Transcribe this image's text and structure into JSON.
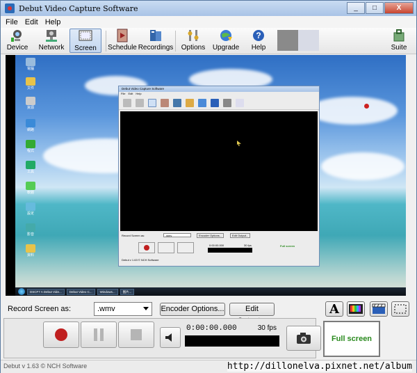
{
  "window": {
    "title": "Debut Video Capture Software",
    "buttons": [
      "_",
      "□",
      "X"
    ]
  },
  "menu": [
    "File",
    "Edit",
    "Help"
  ],
  "toolbar": {
    "items": [
      {
        "label": "Device",
        "icon": "webcam-icon"
      },
      {
        "label": "Network",
        "icon": "network-camera-icon"
      },
      {
        "label": "Screen",
        "icon": "screen-icon",
        "active": true
      },
      {
        "label": "Schedule",
        "icon": "schedule-icon"
      },
      {
        "label": "Recordings",
        "icon": "recordings-icon"
      },
      {
        "label": "Options",
        "icon": "options-icon"
      },
      {
        "label": "Upgrade",
        "icon": "upgrade-globe-icon"
      },
      {
        "label": "Help",
        "icon": "help-icon"
      },
      {
        "label": "Suite",
        "icon": "suite-icon"
      }
    ]
  },
  "preview": {
    "inner_window": {
      "title": "Debut Video Capture Software",
      "menu": [
        "File",
        "Edit",
        "Help"
      ],
      "toolbar": [
        "Device",
        "Network",
        "Screen",
        "Schedule",
        "Recordings",
        "Options",
        "Upgrade",
        "Help",
        "Suite"
      ],
      "record_label": "Record Screen as:",
      "format": ".wmv",
      "encoder": "Encoder Options...",
      "edit_output": "Edit Output...",
      "time": "0:00:00.000",
      "fps": "30 fps",
      "full_screen": "Full screen",
      "status": "Debut v 1.63 © NCH Software"
    },
    "taskbar_items": [
      "DSCF7 A Debut Vide...",
      "Debut Video C...",
      "Windows...",
      "图片..."
    ]
  },
  "controls": {
    "record_label": "Record Screen as:",
    "format_value": ".wmv",
    "encoder_button": "Encoder Options...",
    "edit_output_button": "Edit Output...",
    "time": "0:00:00.000",
    "fps": "30 fps",
    "full_screen": "Full screen"
  },
  "status": {
    "text": "Debut v 1.63 © NCH Software",
    "watermark": "http://dillonelva.pixnet.net/album"
  },
  "colors": {
    "accent": "#2a8a1e",
    "record": "#c02020",
    "title_bar": "#a9c3e6"
  }
}
